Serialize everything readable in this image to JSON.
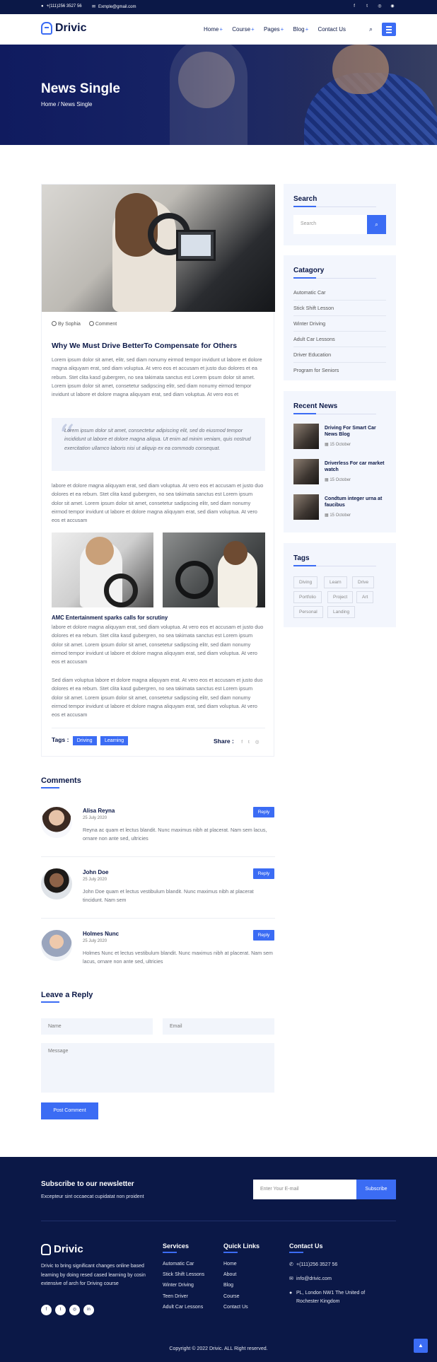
{
  "topbar": {
    "phone": "+(111)256 3527 56",
    "email": "Exmple@gmail.com",
    "socials": [
      "facebook-icon",
      "twitter-icon",
      "instagram-icon",
      "dribbble-icon"
    ]
  },
  "header": {
    "logo": "Drivic",
    "nav": [
      {
        "label": "Home",
        "has_submenu": true
      },
      {
        "label": "Course",
        "has_submenu": true
      },
      {
        "label": "Pages",
        "has_submenu": true
      },
      {
        "label": "Blog",
        "has_submenu": true
      },
      {
        "label": "Contact Us",
        "has_submenu": false
      }
    ]
  },
  "hero": {
    "title": "News Single",
    "breadcrumb_home": "Home",
    "breadcrumb_sep": " / ",
    "breadcrumb_current": "News Single"
  },
  "article": {
    "author": "By Sophia",
    "comment_label": "Comment",
    "title": "Why We Must Drive BetterTo Compensate for Others",
    "para1": "Lorem ipsum dolor sit amet, elitr, sed diam nonumy eirmod tempor invidunt ut labore et dolore magna aliquyam erat, sed diam voluptua. At vero eos et accusam et justo duo dolores et ea rebum. Stet clita kasd gubergren, no sea takimata sanctus est Lorem ipsum dolor sit amet. Lorem ipsum dolor sit amet, consetetur sadipscing elitr, sed diam nonumy eirmod tempor invidunt ut labore et dolore magna aliquyam erat, sed diam voluptua. At vero eos et",
    "quote": "Lorem ipsum dolor sit amet, consectetur adipiscing elit, sed do eiusmod tempor incididunt ut labore et dolore magna aliqua. Ut enim ad minim veniam, quis nostrud exercitation ullamco laboris nisi ut aliquip ex ea commodo consequat.",
    "para2": "labore et dolore magna aliquyam erat, sed diam voluptua. At vero eos et accusam et justo duo dolores et ea rebum. Stet clita kasd gubergren, no sea takimata sanctus est Lorem ipsum dolor sit amet. Lorem ipsum dolor sit amet, consetetur sadipscing elitr, sed diam nonumy eirmod tempor invidunt ut labore et dolore magna aliquyam erat, sed diam voluptua. At vero eos et accusam",
    "subtitle": "AMC Entertainment sparks calls for scrutiny",
    "para3": "labore et dolore magna aliquyam erat, sed diam voluptua. At vero eos et accusam et justo duo dolores et ea rebum. Stet clita kasd gubergren, no sea takimata sanctus est Lorem ipsum dolor sit amet. Lorem ipsum dolor sit amet, consetetur sadipscing elitr, sed diam nonumy eirmod tempor invidunt ut labore et dolore magna aliquyam erat, sed diam voluptua. At vero eos et accusam",
    "para4": "Sed diam voluptua labore et dolore magna aliquyam erat. At vero eos et accusam et justo duo dolores et ea rebum. Stet clita kasd gubergren, no sea takimata sanctus est Lorem ipsum dolor sit amet. Lorem ipsum dolor sit amet, consetetur sadipscing elitr, sed diam nonumy eirmod tempor invidunt ut labore et dolore magna aliquyam erat, sed diam voluptua. At vero eos et accusam",
    "tags_label": "Tags :",
    "tags": [
      "Driving",
      "Learning"
    ],
    "share_label": "Share :"
  },
  "sidebar": {
    "search_title": "Search",
    "search_placeholder": "Search",
    "category_title": "Catagory",
    "categories": [
      "Automatic Car",
      "Stick Shift Lesson",
      "Winter Driving",
      "Adult Car Lessons",
      "Driver Education",
      "Program for Seniors"
    ],
    "recent_title": "Recent News",
    "recent": [
      {
        "title": "Driving For Smart Car News Blog",
        "date": "15 October"
      },
      {
        "title": "Driverless For car market watch",
        "date": "15 October"
      },
      {
        "title": "Condtum integer urna at faucibus",
        "date": "15 October"
      }
    ],
    "tags_title": "Tags",
    "tags": [
      "Diving",
      "Learn",
      "Drive",
      "Portfolio",
      "Project",
      "Art",
      "Personal",
      "Landing"
    ]
  },
  "comments": {
    "title": "Comments",
    "reply_label": "Reply",
    "items": [
      {
        "name": "Alisa Reyna",
        "date": "25 July 2020",
        "text": "Reyna ac quam et lectus blandit. Nunc maximus nibh at placerat. Nam sem lacus, ornare non ante sed, ultricies"
      },
      {
        "name": "John Doe",
        "date": "25 July 2020",
        "text": "John Doe quam et lectus vestibulum blandit. Nunc maximus nibh at placerat tincidunt. Nam sem"
      },
      {
        "name": "Holmes Nunc",
        "date": "25 July 2020",
        "text": "Holmes Nunc et lectus vestibulum blandit. Nunc maximus nibh at placerat. Nam sem lacus, ornare non ante sed, ultricies"
      }
    ]
  },
  "reply_form": {
    "title": "Leave a Reply",
    "name_placeholder": "Name",
    "email_placeholder": "Email",
    "message_placeholder": "Message",
    "submit": "Post Comment"
  },
  "footer": {
    "newsletter_title": "Subscribe to our newsletter",
    "newsletter_sub": "Excepteur sint occaecat cupidatat non proident",
    "newsletter_placeholder": "Enter Your E-mail",
    "subscribe": "Subscribe",
    "logo": "Drivic",
    "description": "Drivic to bring significant changes online based learning by doing resed cased learning by cosin extensive of arch for Driving course",
    "socials": [
      "facebook-icon",
      "twitter-icon",
      "instagram-icon",
      "linkedin-icon"
    ],
    "services_title": "Services",
    "services": [
      "Automatic Car",
      "Stick Shift Lessons",
      "Winter Driving",
      "Teen Driver",
      "Adult Car Lessons"
    ],
    "quick_title": "Quick Links",
    "quick": [
      "Home",
      "About",
      "Blog",
      "Course",
      "Contact Us"
    ],
    "contact_title": "Contact Us",
    "phone": "+(111)256 3527 56",
    "email": "info@drivic.com",
    "address": "PL, London NW1 The United of Rochester Kingdom",
    "copyright": "Copyright © 2022 Drivic. ALL Right reserved."
  }
}
